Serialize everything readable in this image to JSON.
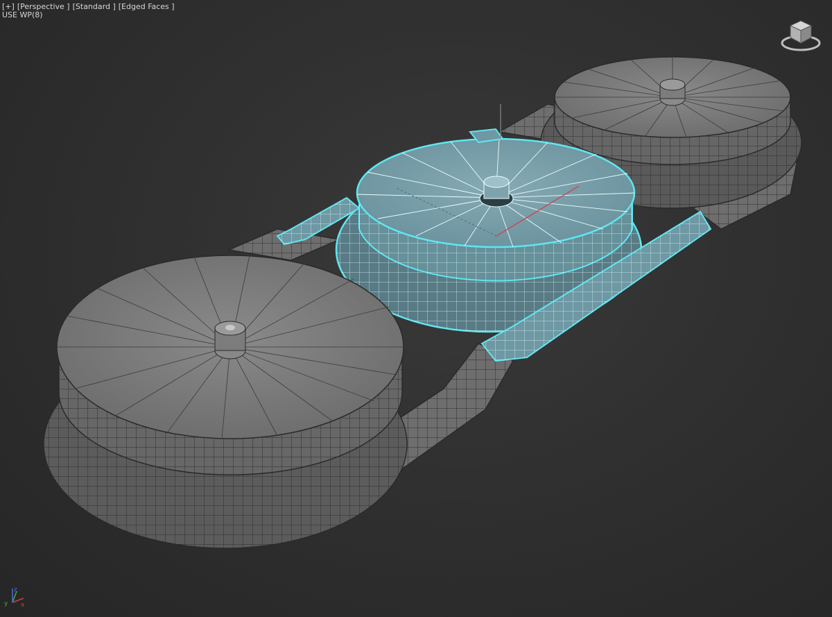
{
  "viewport": {
    "menu_plus": "[+]",
    "menu_view": "[Perspective ]",
    "menu_shading": "[Standard ]",
    "menu_edges": "[Edged Faces ]",
    "workplane_label": "USE WP(8)"
  },
  "scene": {
    "objects": [
      "left-disc-assembly",
      "center-disc-assembly-selected",
      "right-disc-assembly",
      "connector-tubes"
    ],
    "selection_color": "#5fe6f0",
    "selected_fill": "#6f97a2",
    "mesh_fill": "#7a7a7a",
    "wire_color": "#2b2b2b"
  },
  "widgets": {
    "viewcube_icon": "viewcube-icon",
    "axis_icon": "axis-tripod-icon",
    "axis_x": "x",
    "axis_y": "y",
    "axis_z": "z"
  }
}
